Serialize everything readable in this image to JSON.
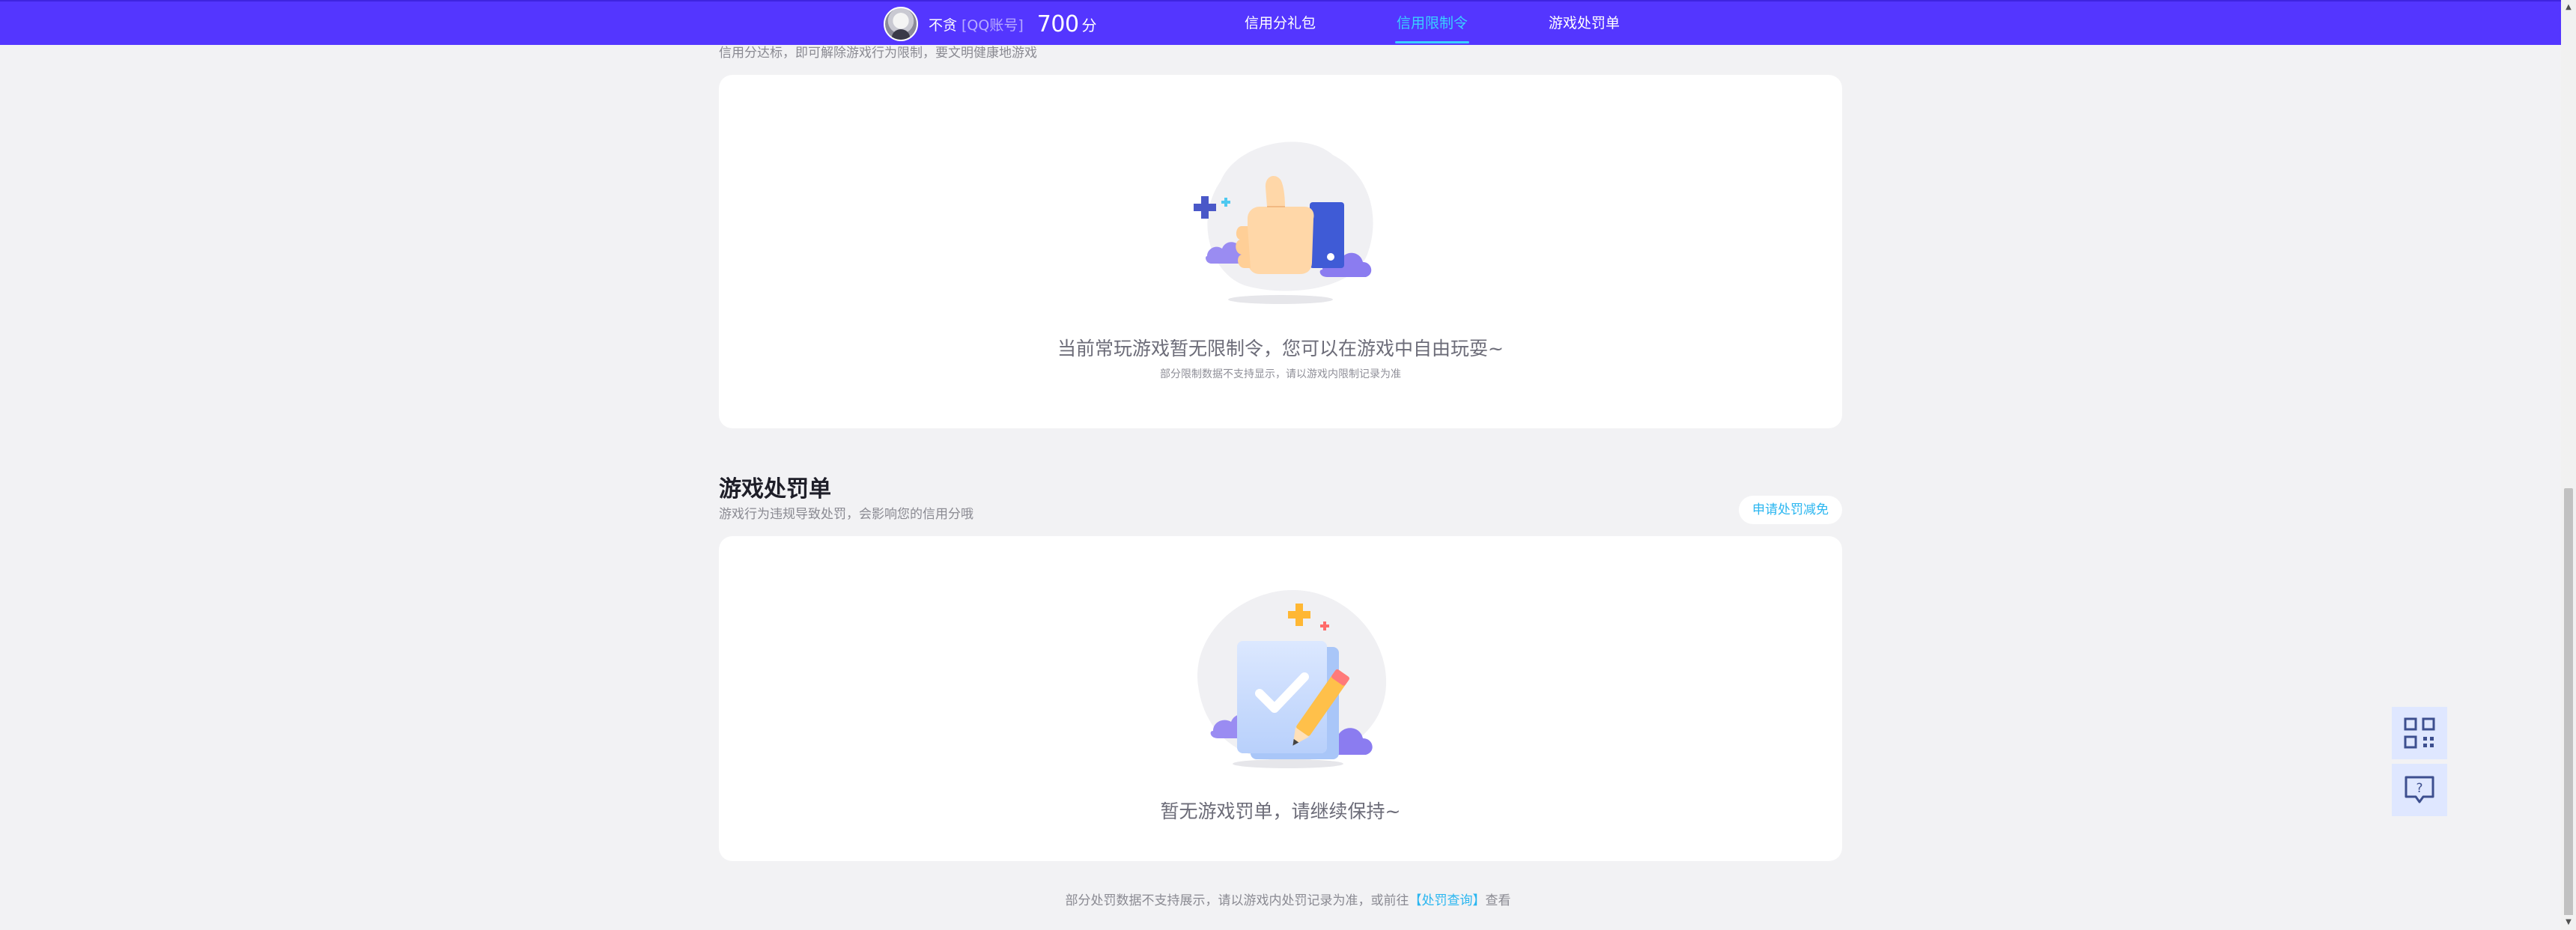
{
  "header": {
    "user_name": "不贪",
    "account_label": "[QQ账号]",
    "score": "700",
    "score_unit": "分",
    "tabs": [
      {
        "label": "信用分礼包",
        "active": false
      },
      {
        "label": "信用限制令",
        "active": true
      },
      {
        "label": "游戏处罚单",
        "active": false
      }
    ]
  },
  "restriction": {
    "description": "信用分达标，即可解除游戏行为限制，要文明健康地游戏",
    "empty_text": "当前常玩游戏暂无限制令，您可以在游戏中自由玩耍~",
    "sub_text": "部分限制数据不支持显示，请以游戏内限制记录为准"
  },
  "penalty": {
    "title": "游戏处罚单",
    "description": "游戏行为违规导致处罚，会影响您的信用分哦",
    "appeal_button": "申请处罚减免",
    "empty_text": "暂无游戏罚单，请继续保持~"
  },
  "footer": {
    "note_prefix": "部分处罚数据不支持展示，请以游戏内处罚记录为准，或前往",
    "link_text": "【处罚查询】",
    "note_suffix": "查看"
  },
  "colors": {
    "nav_background": "#5436ff",
    "active_tab": "#39d0ff",
    "link": "#2ab6f0",
    "page_background": "#f2f2f4"
  },
  "icons": {
    "qr": "qr-code-icon",
    "help": "help-chat-icon",
    "thumbs_up": "thumbs-up-illustration",
    "clipboard": "clipboard-check-illustration"
  }
}
